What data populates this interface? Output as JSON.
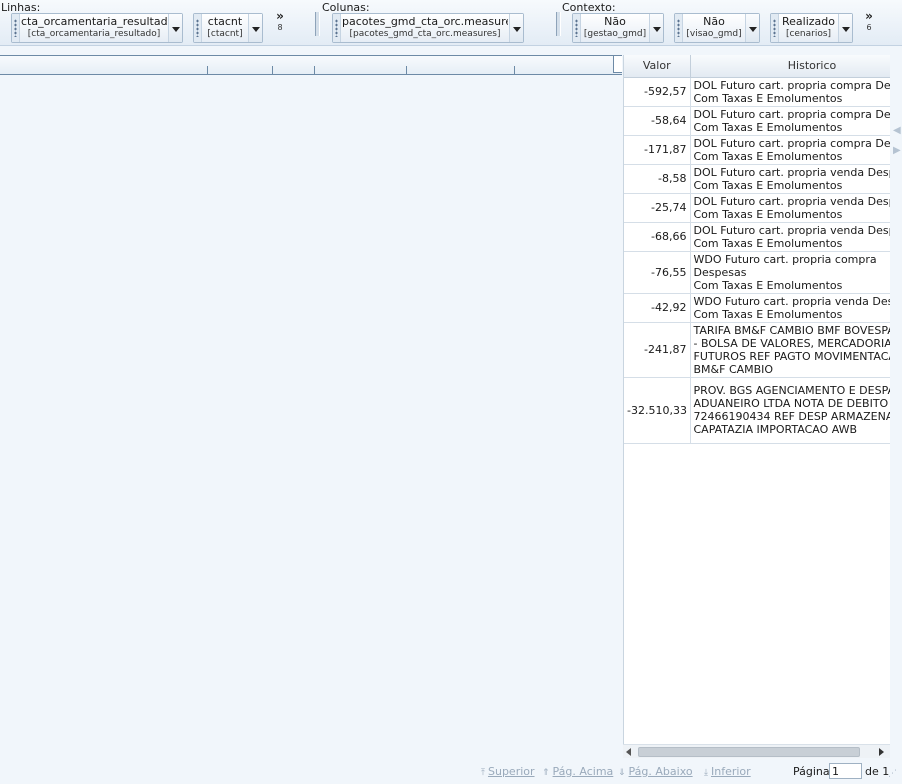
{
  "toolbar": {
    "linhas": {
      "label": "Linhas:",
      "chips": [
        {
          "main": "cta_orcamentaria_resultado",
          "sub": "[cta_orcamentaria_resultado]"
        },
        {
          "main": "ctacnt",
          "sub": "[ctacnt]"
        }
      ],
      "more_symbol": "»",
      "more_count": "8"
    },
    "colunas": {
      "label": "Colunas:",
      "chips": [
        {
          "main": "pacotes_gmd_cta_orc.measures",
          "sub": "[pacotes_gmd_cta_orc.measures]"
        }
      ]
    },
    "contexto": {
      "label": "Contexto:",
      "chips": [
        {
          "main": "Não",
          "sub": "[gestao_gmd]"
        },
        {
          "main": "Não",
          "sub": "[visao_gmd]"
        },
        {
          "main": "Realizado",
          "sub": "[cenarios]"
        }
      ],
      "more_symbol": "»",
      "more_count": "6"
    }
  },
  "grid": {
    "columns": [
      "Valor",
      "Historico"
    ],
    "rows": [
      {
        "valor": "-592,57",
        "historico": "DOL Futuro cart. propria compra Despesas\nCom Taxas E Emolumentos"
      },
      {
        "valor": "-58,64",
        "historico": "DOL Futuro cart. propria compra Despesas\nCom Taxas E Emolumentos"
      },
      {
        "valor": "-171,87",
        "historico": "DOL Futuro cart. propria compra Despesas\nCom Taxas E Emolumentos"
      },
      {
        "valor": "-8,58",
        "historico": "DOL Futuro cart. propria venda Despesas\nCom Taxas E Emolumentos"
      },
      {
        "valor": "-25,74",
        "historico": "DOL Futuro cart. propria venda Despesas\nCom Taxas E Emolumentos"
      },
      {
        "valor": "-68,66",
        "historico": "DOL Futuro cart. propria venda Despesas\nCom Taxas E Emolumentos"
      },
      {
        "valor": "-76,55",
        "historico": "WDO Futuro cart. propria compra Despesas\nCom Taxas E Emolumentos"
      },
      {
        "valor": "-42,92",
        "historico": "WDO Futuro cart. propria venda Despesas\nCom Taxas E Emolumentos"
      },
      {
        "valor": "-241,87",
        "historico": "TARIFA BM&F CAMBIO BMF BOVESPA S.A.\n- BOLSA DE VALORES, MERCADORIAS E\nFUTUROS REF PAGTO MOVIMENTACAO\nBM&F CAMBIO"
      },
      {
        "valor": "-32.510,33",
        "historico": "PROV. BGS AGENCIAMENTO E DESPACHO\nADUANEIRO LTDA NOTA DE DEBITO\n72466190434 REF DESP ARMAZENAGEM E\nCAPATAZIA IMPORTACAO AWB"
      }
    ]
  },
  "footer": {
    "superior": "Superior",
    "pag_acima": "Pág. Acima",
    "pag_abaixo": "Pág. Abaixo",
    "inferior": "Inferior",
    "pagina_label": "Página",
    "page_value": "1",
    "de_label": "de 1"
  },
  "icons": {
    "superior": "superior-arrow-icon",
    "pag_acima": "page-up-arrow-icon",
    "pag_abaixo": "page-down-arrow-icon",
    "inferior": "inferior-arrow-icon"
  },
  "colors": {
    "background": "#f1f6fb",
    "grid_border": "#6d8aa6",
    "disabled_link": "#9aaabb"
  }
}
